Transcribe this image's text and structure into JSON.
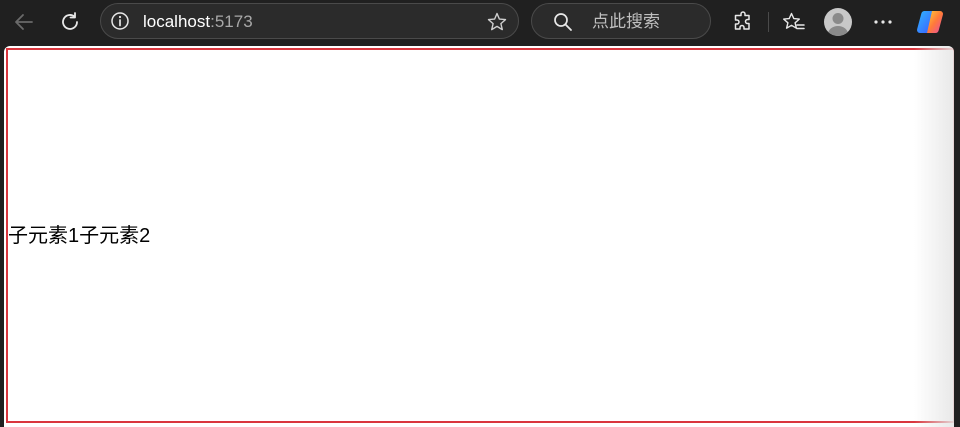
{
  "browser": {
    "address_bar": {
      "host": "localhost",
      "port": ":5173"
    },
    "search": {
      "placeholder": "点此搜索"
    },
    "icons": {
      "back": "arrow-left-icon",
      "refresh": "refresh-icon",
      "info": "info-icon",
      "favorite": "star-icon",
      "search": "search-icon",
      "extensions": "puzzle-icon",
      "favorites": "favorites-icon",
      "profile": "avatar-icon",
      "more": "more-icon",
      "copilot": "copilot-icon"
    }
  },
  "page": {
    "children": [
      {
        "text": "子元素1"
      },
      {
        "text": "子元素2"
      }
    ],
    "container_border_color": "#d9363e"
  }
}
